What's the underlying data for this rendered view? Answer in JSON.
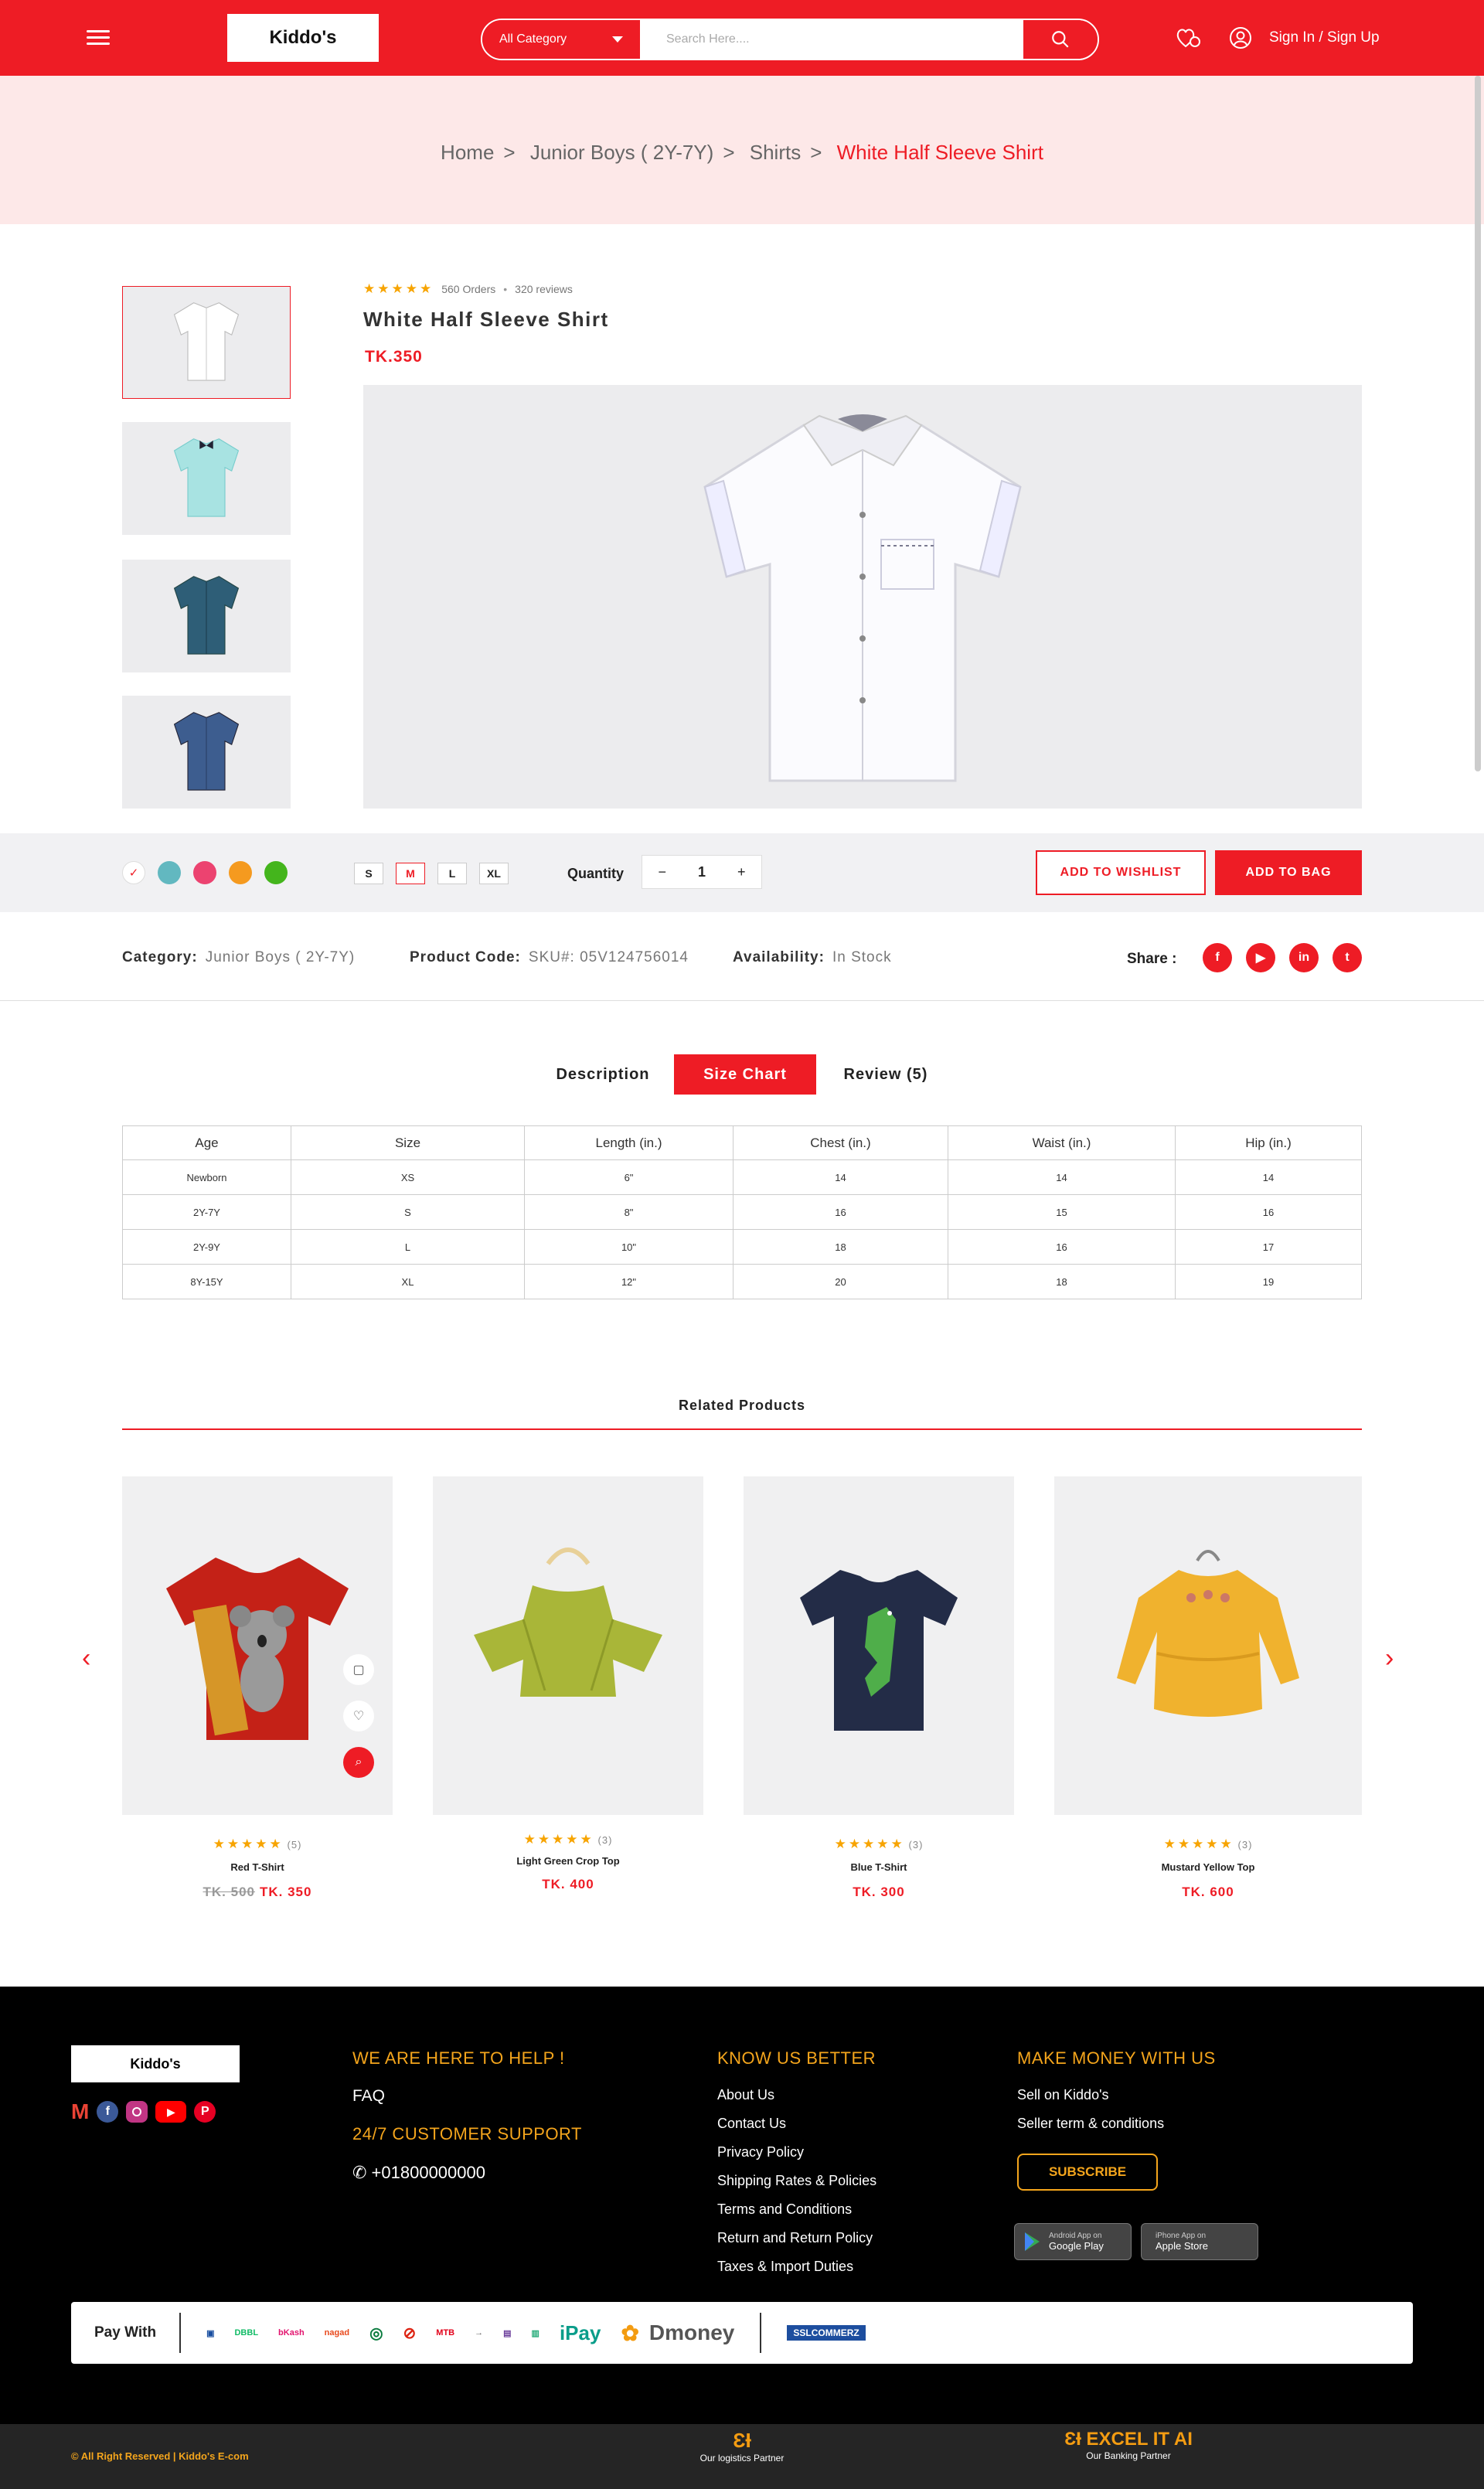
{
  "header": {
    "logo": "Kiddo's",
    "category": "All Category",
    "search_placeholder": "Search Here....",
    "signin": "Sign In / Sign Up"
  },
  "breadcrumb": [
    "Home",
    "Junior Boys ( 2Y-7Y)",
    "Shirts",
    "White Half Sleeve Shirt"
  ],
  "product": {
    "orders": "560 Orders",
    "reviews": "320 reviews",
    "title": "White Half Sleeve Shirt",
    "price": "TK.350",
    "colors": [
      "#ffffff",
      "#62b8c0",
      "#ec4370",
      "#f59a1f",
      "#44b51c"
    ],
    "sizes": [
      "S",
      "M",
      "L",
      "XL"
    ],
    "selected_size": "M",
    "quantity_label": "Quantity",
    "quantity": "1",
    "wishlist": "ADD TO WISHLIST",
    "bag": "ADD TO BAG"
  },
  "info": {
    "category_label": "Category:",
    "category": "Junior Boys ( 2Y-7Y)",
    "code_label": "Product Code:",
    "code": "SKU#: 05V124756014",
    "avail_label": "Availability:",
    "avail": "In Stock",
    "share": "Share :"
  },
  "tabs": [
    "Description",
    "Size Chart",
    "Review (5)"
  ],
  "size_chart": {
    "headers": [
      "Age",
      "Size",
      "Length (in.)",
      "Chest (in.)",
      "Waist (in.)",
      "Hip (in.)"
    ],
    "rows": [
      [
        "Newborn",
        "XS",
        "6\"",
        "14",
        "14",
        "14"
      ],
      [
        "2Y-7Y",
        "S",
        "8\"",
        "16",
        "15",
        "16"
      ],
      [
        "2Y-9Y",
        "L",
        "10\"",
        "18",
        "16",
        "17"
      ],
      [
        "8Y-15Y",
        "XL",
        "12\"",
        "20",
        "18",
        "19"
      ]
    ]
  },
  "related": {
    "title": "Related Products",
    "items": [
      {
        "name": "Red T-Shirt",
        "count": "(5)",
        "old": "TK. 500",
        "price": "TK. 350"
      },
      {
        "name": "Light Green Crop Top",
        "count": "(3)",
        "price": "TK. 400"
      },
      {
        "name": "Blue T-Shirt",
        "count": "(3)",
        "price": "TK. 300"
      },
      {
        "name": "Mustard Yellow Top",
        "count": "(3)",
        "price": "TK. 600"
      }
    ]
  },
  "footer": {
    "logo": "Kiddo's",
    "help_title": "WE ARE HERE TO HELP !",
    "faq": "FAQ",
    "support_title": "24/7 CUSTOMER SUPPORT",
    "phone": "+01800000000",
    "know_title": "KNOW US BETTER",
    "know_links": [
      "About Us",
      "Contact Us",
      "Privacy Policy",
      "Shipping Rates & Policies",
      "Terms and Conditions",
      "Return and Return Policy",
      "Taxes & Import Duties"
    ],
    "money_title": "MAKE MONEY WITH US",
    "money_links": [
      "Sell on Kiddo's",
      "Seller term & conditions"
    ],
    "subscribe": "SUBSCRIBE",
    "android_small": "Android App on",
    "android": "Google Play",
    "iphone_small": "iPhone App on",
    "iphone": "Apple Store",
    "pay_with": "Pay With",
    "payments": [
      "DBBL",
      "bKash",
      "nagad",
      "MTB",
      "iPay",
      "Dmoney",
      "SSLCOMMERZ"
    ],
    "copyright": "All Right Reserved | Kiddo's E-com",
    "logistics": "Our logistics Partner",
    "banking_brand": "EXCEL IT AI",
    "banking": "Our Banking Partner"
  }
}
